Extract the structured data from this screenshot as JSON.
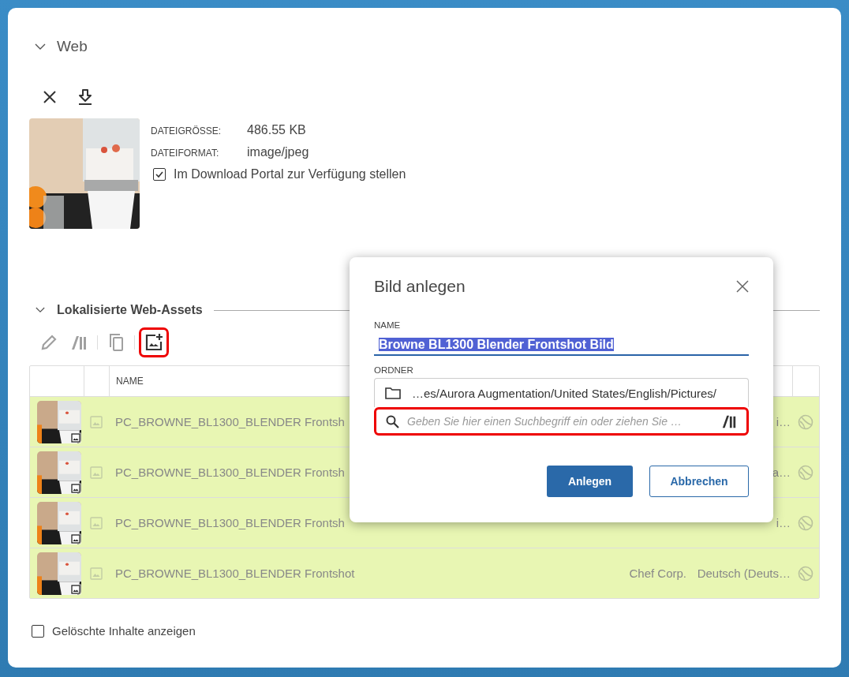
{
  "section": {
    "title": "Web",
    "expanded": true
  },
  "file_info": [
    {
      "label": "DATEIGRÖSSE:",
      "value": "486.55 KB"
    },
    {
      "label": "DATEIFORMAT:",
      "value": "image/jpeg"
    }
  ],
  "download_portal": {
    "label": "Im Download Portal zur Verfügung stellen",
    "checked": true
  },
  "assets": {
    "title": "Lokalisierte Web-Assets",
    "expanded": true,
    "toolbar": [
      {
        "kind": "edit",
        "disabled": true,
        "highlighted": false
      },
      {
        "kind": "library",
        "disabled": true,
        "highlighted": false
      },
      {
        "kind": "copy",
        "disabled": true,
        "highlighted": false
      },
      {
        "kind": "add-image",
        "disabled": false,
        "highlighted": true
      }
    ],
    "columns": [
      "NAME"
    ],
    "rows": [
      {
        "name": "PC_BROWNE_BL1300_BLENDER Frontsh",
        "column_4": "",
        "column_5": "i…",
        "selected": true
      },
      {
        "name": "PC_BROWNE_BL1300_BLENDER Frontsh",
        "column_4": "",
        "column_5": "a…",
        "selected": true
      },
      {
        "name": "PC_BROWNE_BL1300_BLENDER Frontsh",
        "column_4": "",
        "column_5": "i…",
        "selected": true
      },
      {
        "name": "PC_BROWNE_BL1300_BLENDER Frontshot",
        "column_4": "Chef Corp.",
        "column_5": "Deutsch (Deuts…",
        "selected": true
      }
    ]
  },
  "show_deleted": {
    "label": "Gelöschte Inhalte anzeigen",
    "checked": false
  },
  "dialog": {
    "title": "Bild anlegen",
    "name_label": "NAME",
    "name_value": "Browne BL1300 Blender Frontshot Bild",
    "folder_label": "ORDNER",
    "folder_path": "…es/Aurora Augmentation/United States/English/Pictures/",
    "search_placeholder": "Geben Sie hier einen Suchbegriff ein oder ziehen Sie …",
    "search_highlighted": true,
    "buttons": [
      {
        "label": "Anlegen",
        "kind": "primary"
      },
      {
        "label": "Abbrechen",
        "kind": "secondary"
      }
    ]
  }
}
